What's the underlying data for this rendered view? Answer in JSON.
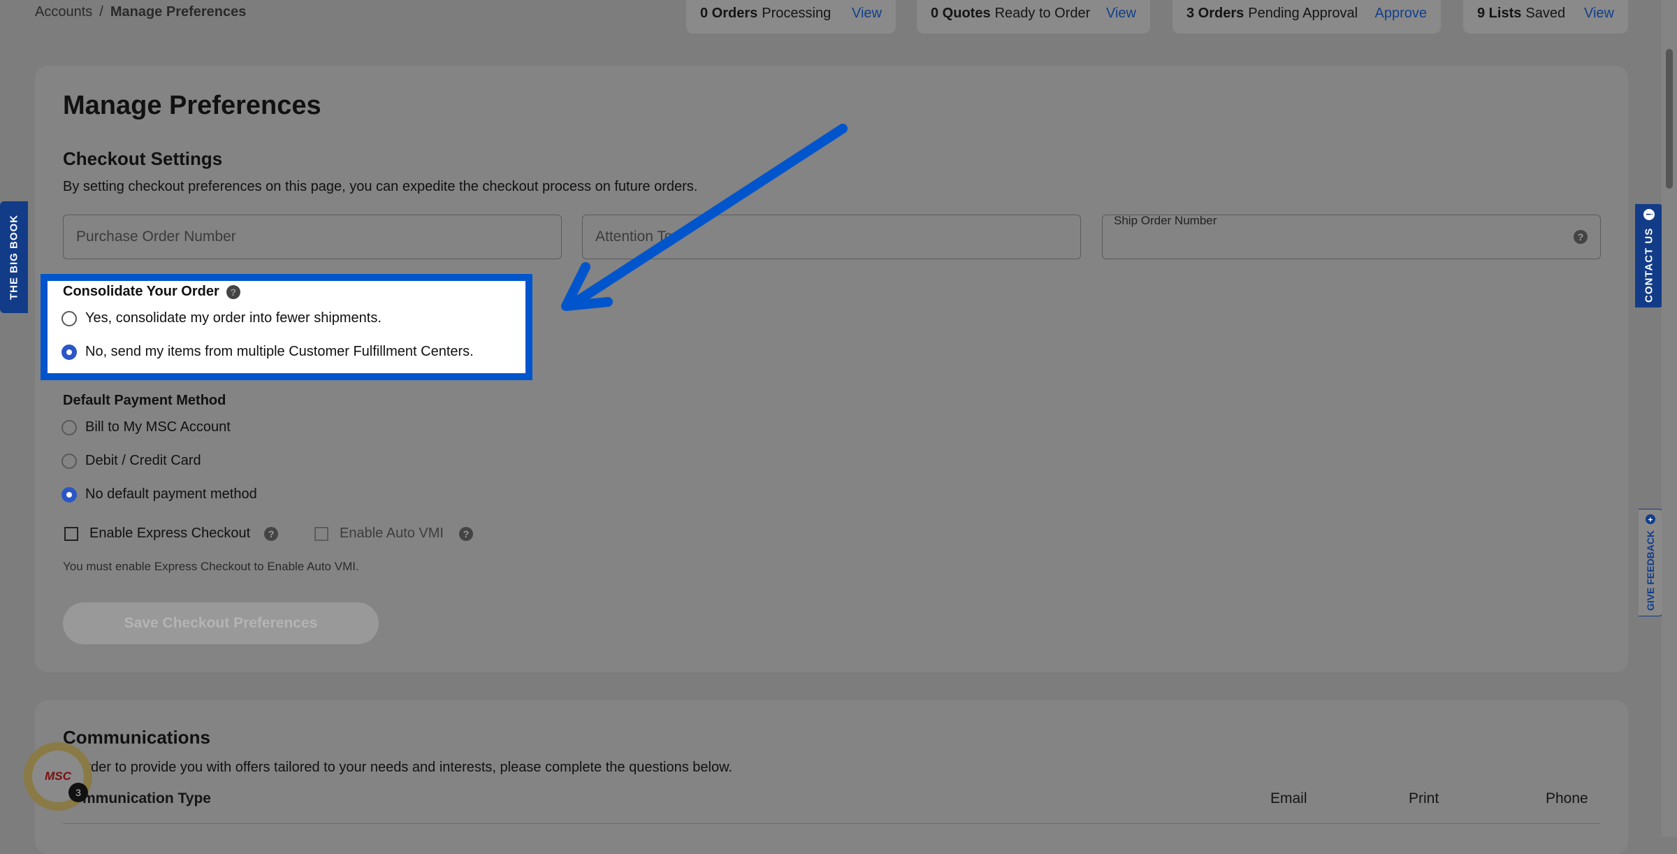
{
  "breadcrumb": {
    "root": "Accounts",
    "separator": "/",
    "current": "Manage Preferences"
  },
  "status": [
    {
      "bold": "0 Orders",
      "text": "Processing",
      "link": "View"
    },
    {
      "bold": "0 Quotes",
      "text": "Ready to Order",
      "link": "View"
    },
    {
      "bold": "3 Orders",
      "text": "Pending Approval",
      "link": "Approve"
    },
    {
      "bold": "9 Lists",
      "text": "Saved",
      "link": "View"
    }
  ],
  "page": {
    "title": "Manage Preferences",
    "checkout_title": "Checkout Settings",
    "checkout_desc": "By setting checkout preferences on this page, you can expedite the checkout process on future orders."
  },
  "fields": {
    "po_placeholder": "Purchase Order Number",
    "attention_placeholder": "Attention To",
    "ship_label": "Ship Order Number",
    "ship_value": ""
  },
  "consolidate": {
    "label": "Consolidate Your Order",
    "options": [
      {
        "label": "Yes, consolidate my order into fewer shipments.",
        "selected": false
      },
      {
        "label": "No, send my items from multiple Customer Fulfillment Centers.",
        "selected": true
      }
    ]
  },
  "payment": {
    "label": "Default Payment Method",
    "options": [
      {
        "label": "Bill to My MSC Account",
        "selected": false
      },
      {
        "label": "Debit / Credit Card",
        "selected": false
      },
      {
        "label": "No default payment method",
        "selected": true
      }
    ]
  },
  "express": {
    "label": "Enable Express Checkout",
    "checked": false
  },
  "auto_vmi": {
    "label": "Enable Auto VMI",
    "checked": false,
    "disabled": true
  },
  "express_note": "You must enable Express Checkout to Enable Auto VMI.",
  "save_button": "Save Checkout Preferences",
  "communications": {
    "title": "Communications",
    "desc": "In order to provide you with offers tailored to your needs and interests, please complete the questions below.",
    "col_type": "Communication Type",
    "col_email": "Email",
    "col_print": "Print",
    "col_phone": "Phone"
  },
  "side_tabs": {
    "big_book": "THE BIG BOOK",
    "contact": "CONTACT US",
    "feedback": "GIVE FEEDBACK"
  },
  "chat": {
    "logo": "MSC",
    "badge": "3"
  },
  "colors": {
    "accent": "#0055cc",
    "brand_blue": "#123c88",
    "overlay": "#7d7d7d"
  }
}
